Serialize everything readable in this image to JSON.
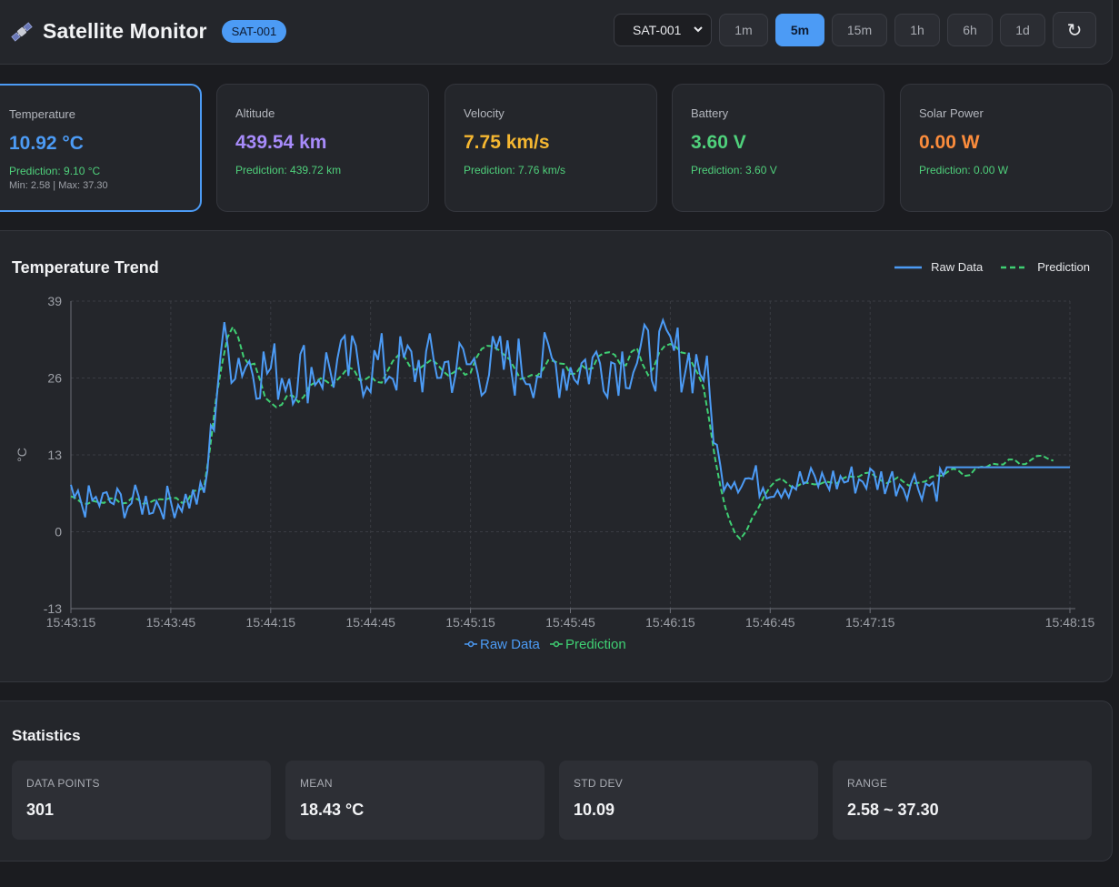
{
  "header": {
    "title": "Satellite Monitor",
    "icon": "satellite-icon",
    "badge": "SAT-001",
    "satellite_select": "SAT-001",
    "ranges": [
      "1m",
      "5m",
      "15m",
      "1h",
      "6h",
      "1d"
    ],
    "active_range": "5m",
    "refresh_icon": "↻"
  },
  "metrics": [
    {
      "label": "Temperature",
      "value": "10.92 °C",
      "prediction": "Prediction: 9.10 °C",
      "minmax": "Min: 2.58 | Max: 37.30",
      "color": "#4c9bf5",
      "selected": true
    },
    {
      "label": "Altitude",
      "value": "439.54 km",
      "prediction": "Prediction: 439.72 km",
      "color": "#a78bfa"
    },
    {
      "label": "Velocity",
      "value": "7.75 km/s",
      "prediction": "Prediction: 7.76 km/s",
      "color": "#f5b731"
    },
    {
      "label": "Battery",
      "value": "3.60 V",
      "prediction": "Prediction: 3.60 V",
      "color": "#4fd07b"
    },
    {
      "label": "Solar Power",
      "value": "0.00 W",
      "prediction": "Prediction: 0.00 W",
      "color": "#fb8c3c"
    }
  ],
  "chart": {
    "title": "Temperature Trend",
    "legend_top": [
      "Raw Data",
      "Prediction"
    ],
    "legend_bottom": [
      "Raw Data",
      "Prediction"
    ],
    "colors": {
      "raw": "#4c9bf5",
      "prediction": "#3fcf73"
    }
  },
  "chart_data": {
    "type": "line",
    "title": "Temperature Trend",
    "xlabel": "",
    "ylabel": "°C",
    "ylim": [
      -13,
      39
    ],
    "yticks": [
      39,
      26,
      13,
      0,
      -13
    ],
    "xlim": [
      "15:43:15",
      "15:48:15"
    ],
    "xticks": [
      "15:43:15",
      "15:43:45",
      "15:44:15",
      "15:44:45",
      "15:45:15",
      "15:45:45",
      "15:46:15",
      "15:46:45",
      "15:47:15",
      "15:48:15"
    ],
    "grid": true,
    "legend": "top-right",
    "series": [
      {
        "name": "Raw Data",
        "x": [
          "15:43:15",
          "15:43:30",
          "15:43:45",
          "15:43:55",
          "15:44:00",
          "15:44:15",
          "15:44:45",
          "15:45:15",
          "15:45:45",
          "15:46:15",
          "15:46:25",
          "15:46:30",
          "15:46:45",
          "15:47:15",
          "15:47:35",
          "15:47:38",
          "15:48:15"
        ],
        "y": [
          5,
          5,
          5,
          6,
          31,
          27,
          28,
          28,
          28,
          30,
          28,
          10,
          8,
          9,
          8,
          10.9,
          10.9
        ]
      },
      {
        "name": "Prediction",
        "x": [
          "15:43:15",
          "15:43:30",
          "15:43:45",
          "15:43:55",
          "15:44:02",
          "15:44:15",
          "15:44:45",
          "15:45:15",
          "15:45:45",
          "15:46:15",
          "15:46:25",
          "15:46:30",
          "15:46:36",
          "15:46:45",
          "15:47:15",
          "15:47:45",
          "15:48:10"
        ],
        "y": [
          6,
          5,
          6,
          6,
          36,
          22,
          28,
          28,
          28,
          30,
          30,
          5,
          -1,
          9,
          9,
          10,
          12
        ]
      }
    ]
  },
  "statistics": {
    "title": "Statistics",
    "items": [
      {
        "label": "DATA POINTS",
        "value": "301"
      },
      {
        "label": "MEAN",
        "value": "18.43 °C"
      },
      {
        "label": "STD DEV",
        "value": "10.09"
      },
      {
        "label": "RANGE",
        "value": "2.58 ~ 37.30"
      }
    ]
  }
}
